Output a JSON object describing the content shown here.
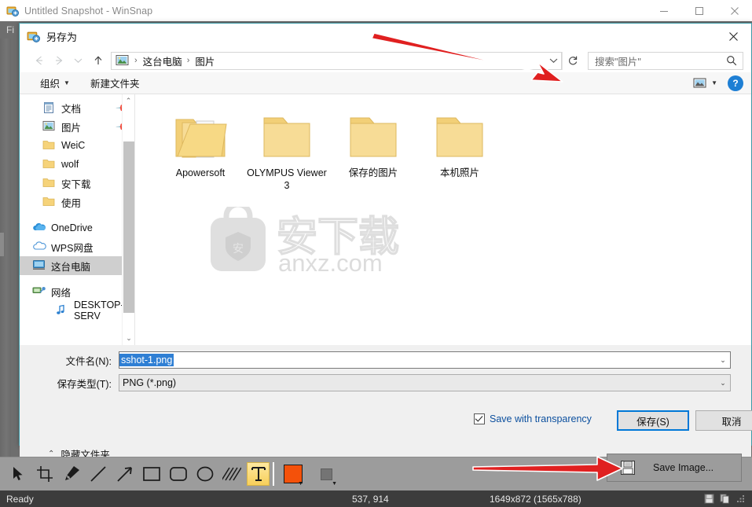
{
  "app": {
    "title": "Untitled Snapshot - WinSnap",
    "icon": "winsnap-icon",
    "menu": {
      "file_label": "Fi"
    },
    "window_buttons": [
      {
        "name": "minimize",
        "glyph": "–"
      },
      {
        "name": "maximize",
        "glyph": "□"
      },
      {
        "name": "close",
        "glyph": "✕"
      }
    ]
  },
  "dialog": {
    "title": "另存为",
    "icon": "winsnap-icon",
    "close_glyph": "✕",
    "nav": {
      "back_glyph": "←",
      "forward_glyph": "→",
      "history_glyph": "⌄",
      "up_glyph": "↑",
      "address_icon": "pictures-icon",
      "breadcrumbs": [
        "这台电脑",
        "图片"
      ],
      "separator": "›",
      "dropdown_glyph": "⌄",
      "refresh_glyph": "↻",
      "search_placeholder": "搜索\"图片\"",
      "search_value": ""
    },
    "command_bar": {
      "organize_label": "组织",
      "organize_caret": "▼",
      "new_folder_label": "新建文件夹",
      "view_icon": "view-layout-icon",
      "view_caret": "▼",
      "help_label": "?"
    },
    "tree": [
      {
        "label": "文档",
        "icon": "documents-icon",
        "pinned": true,
        "selected": false,
        "indent": 1
      },
      {
        "label": "图片",
        "icon": "pictures-icon",
        "pinned": true,
        "selected": false,
        "indent": 1
      },
      {
        "label": "WeiC",
        "icon": "folder-icon",
        "pinned": false,
        "selected": false,
        "indent": 1
      },
      {
        "label": "wolf",
        "icon": "folder-icon",
        "pinned": false,
        "selected": false,
        "indent": 1
      },
      {
        "label": "安下载",
        "icon": "folder-icon",
        "pinned": false,
        "selected": false,
        "indent": 1
      },
      {
        "label": "使用",
        "icon": "folder-icon",
        "pinned": false,
        "selected": false,
        "indent": 1
      },
      {
        "label": "OneDrive",
        "icon": "onedrive-icon",
        "pinned": false,
        "selected": false,
        "indent": 0
      },
      {
        "label": "WPS网盘",
        "icon": "cloud-icon",
        "pinned": false,
        "selected": false,
        "indent": 0
      },
      {
        "label": "这台电脑",
        "icon": "this-pc-icon",
        "pinned": false,
        "selected": true,
        "indent": 0
      },
      {
        "label": "网络",
        "icon": "network-icon",
        "pinned": false,
        "selected": false,
        "indent": 0
      },
      {
        "label": "DESKTOP-SERV",
        "icon": "media-note-icon",
        "pinned": false,
        "selected": false,
        "indent": 1
      }
    ],
    "tree_scroll": {
      "up_glyph": "⌃",
      "down_glyph": "⌄"
    },
    "folders": [
      {
        "name": "Apowersoft",
        "icon": "folder-with-images-icon"
      },
      {
        "name": "OLYMPUS Viewer 3",
        "icon": "folder-icon"
      },
      {
        "name": "保存的图片",
        "icon": "folder-icon"
      },
      {
        "name": "本机照片",
        "icon": "folder-icon"
      }
    ],
    "watermark": {
      "text": "anxz.com",
      "glyph": "安"
    },
    "form": {
      "filename_label": "文件名(N):",
      "filename_value": "sshot-1.png",
      "filetype_label": "保存类型(T):",
      "filetype_value": "PNG (*.png)",
      "dropdown_glyph": "⌄"
    },
    "footer": {
      "hide_folders_label": "隐藏文件夹",
      "hide_folders_chevron": "⌃",
      "transparency_label": "Save with transparency",
      "transparency_checked": true,
      "save_label": "保存(S)",
      "cancel_label": "取消"
    }
  },
  "toolbar": {
    "tools": [
      {
        "name": "select-tool",
        "icon": "cursor-icon",
        "active": false
      },
      {
        "name": "crop-tool",
        "icon": "crop-icon",
        "active": false
      },
      {
        "name": "pen-tool",
        "icon": "pen-icon",
        "active": false
      },
      {
        "name": "line-tool",
        "icon": "line-icon",
        "active": false
      },
      {
        "name": "arrow-tool",
        "icon": "arrow-icon",
        "active": false
      },
      {
        "name": "rectangle-tool",
        "icon": "rectangle-icon",
        "active": false
      },
      {
        "name": "rounded-rectangle-tool",
        "icon": "rounded-rectangle-icon",
        "active": false
      },
      {
        "name": "ellipse-tool",
        "icon": "ellipse-icon",
        "active": false
      },
      {
        "name": "hatch-tool",
        "icon": "hatch-icon",
        "active": false
      },
      {
        "name": "text-tool",
        "icon": "text-t-icon",
        "active": true
      }
    ],
    "foreground_color": "#f4510a",
    "secondary_color": "#747474",
    "color_caret": "▼",
    "save_image_label": "Save Image...",
    "save_image_icon": "floppy-disk-icon"
  },
  "status_bar": {
    "ready": "Ready",
    "coordinates": "537, 914",
    "image_size": "1649x872 (1565x788)",
    "icons": [
      "floppy-disk-icon",
      "copy-icon",
      "resize-grip-icon"
    ]
  },
  "annotations": {
    "arrow_color": "#e02020",
    "arrows": [
      {
        "name": "arrow-to-address-bar"
      },
      {
        "name": "arrow-to-save-image-button"
      }
    ]
  }
}
